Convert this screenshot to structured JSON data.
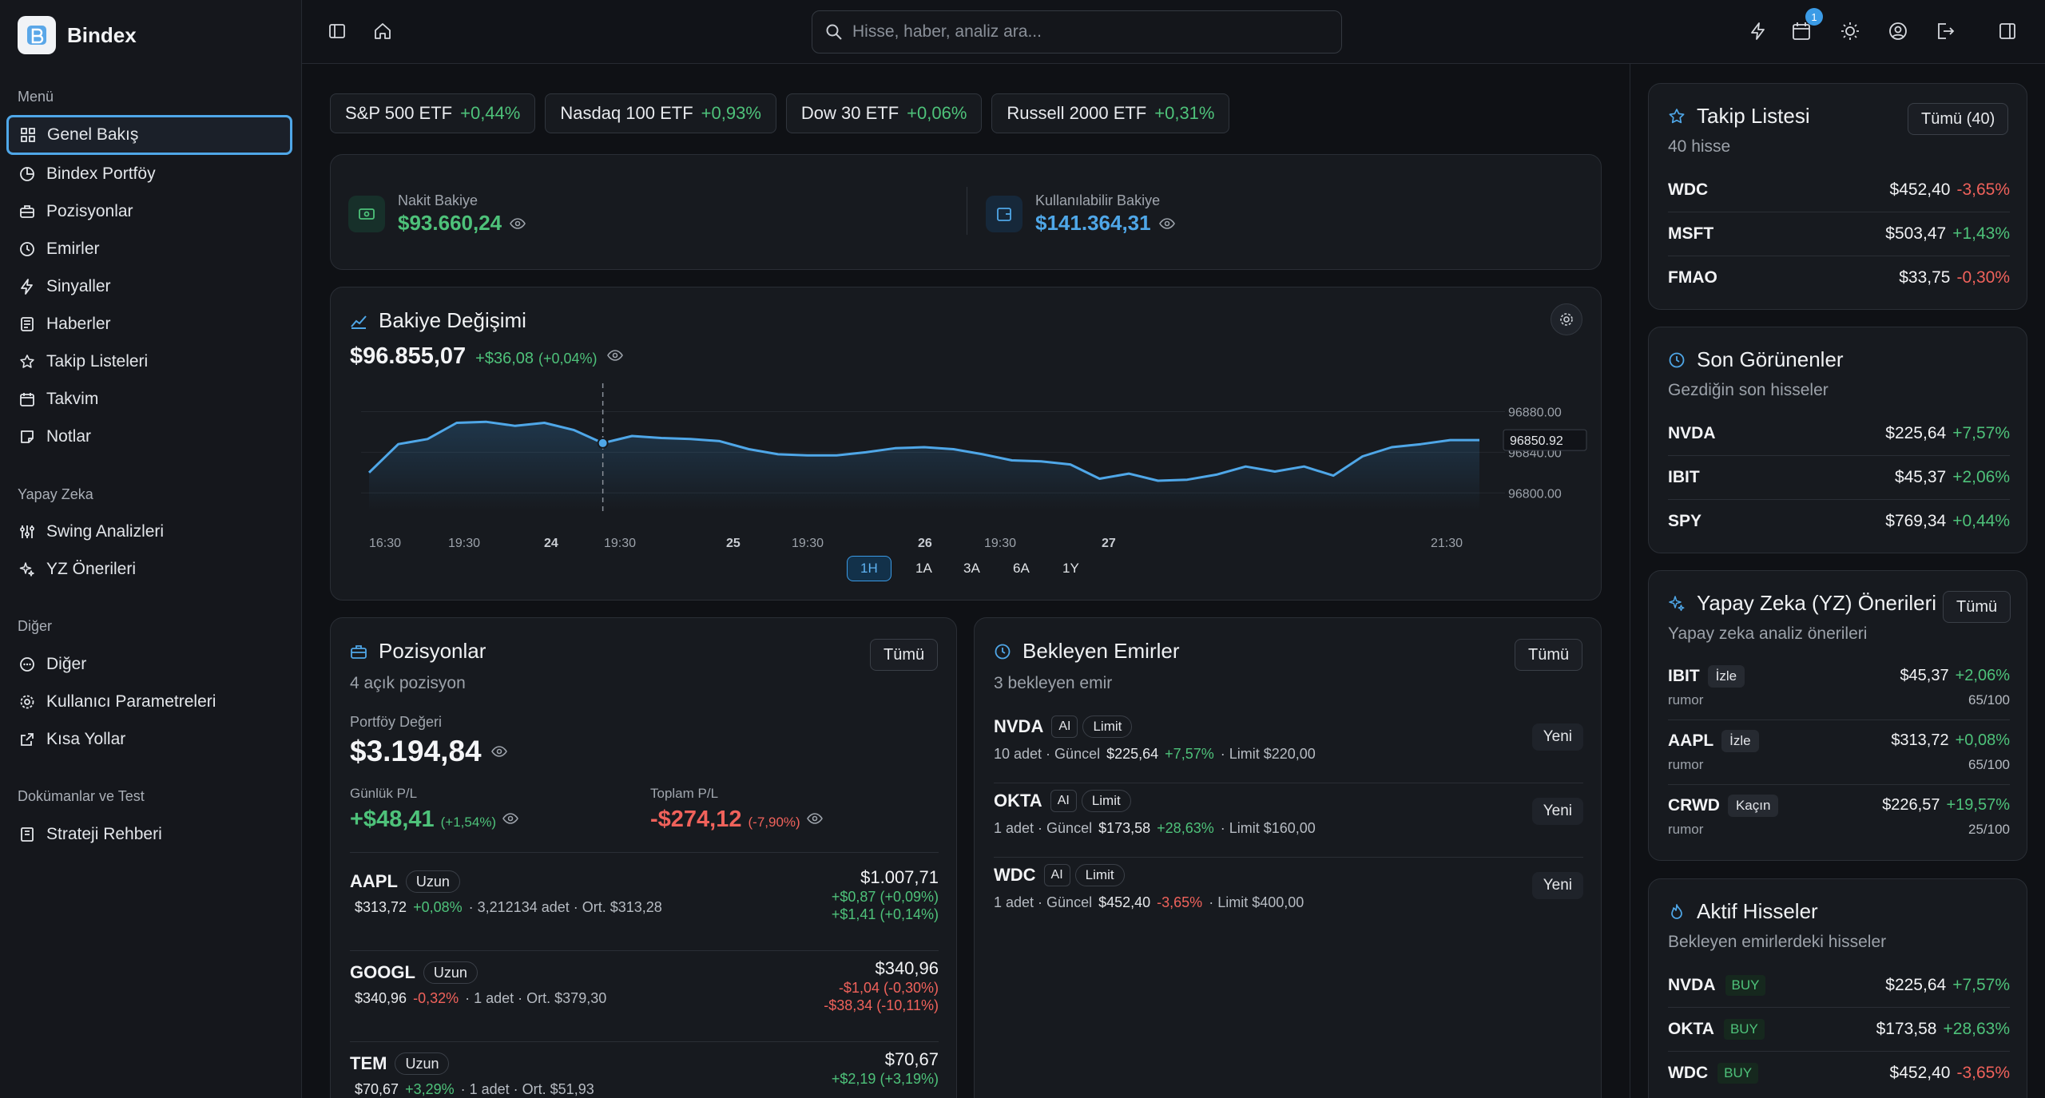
{
  "app": {
    "name": "Bindex"
  },
  "sidebar": {
    "sections": [
      {
        "title": "Menü",
        "items": [
          {
            "label": "Genel Bakış",
            "icon": "dashboard-icon"
          },
          {
            "label": "Bindex Portföy",
            "icon": "pie-chart-icon"
          },
          {
            "label": "Pozisyonlar",
            "icon": "briefcase-icon"
          },
          {
            "label": "Emirler",
            "icon": "clock-icon"
          },
          {
            "label": "Sinyaller",
            "icon": "lightning-icon"
          },
          {
            "label": "Haberler",
            "icon": "newspaper-icon"
          },
          {
            "label": "Takip Listeleri",
            "icon": "star-icon"
          },
          {
            "label": "Takvim",
            "icon": "calendar-icon"
          },
          {
            "label": "Notlar",
            "icon": "note-icon"
          }
        ]
      },
      {
        "title": "Yapay Zeka",
        "items": [
          {
            "label": "Swing Analizleri",
            "icon": "sliders-icon"
          },
          {
            "label": "YZ Önerileri",
            "icon": "sparkles-icon"
          }
        ]
      },
      {
        "title": "Diğer",
        "items": [
          {
            "label": "Diğer",
            "icon": "more-circle-icon"
          },
          {
            "label": "Kullanıcı Parametreleri",
            "icon": "gear-icon"
          },
          {
            "label": "Kısa Yollar",
            "icon": "external-link-icon"
          }
        ]
      },
      {
        "title": "Dokümanlar ve Test",
        "items": [
          {
            "label": "Strateji Rehberi",
            "icon": "book-icon"
          }
        ]
      }
    ]
  },
  "topbar": {
    "search_placeholder": "Hisse, haber, analiz ara...",
    "notification_count": "1"
  },
  "index_chips": [
    {
      "name": "S&P 500 ETF",
      "change": "+0,44%"
    },
    {
      "name": "Nasdaq 100 ETF",
      "change": "+0,93%"
    },
    {
      "name": "Dow 30 ETF",
      "change": "+0,06%"
    },
    {
      "name": "Russell 2000 ETF",
      "change": "+0,31%"
    }
  ],
  "balances": {
    "cash_label": "Nakit Bakiye",
    "cash_value": "$93.660,24",
    "available_label": "Kullanılabilir Bakiye",
    "available_value": "$141.364,31"
  },
  "balance_chart": {
    "title": "Bakiye Değişimi",
    "value": "$96.855,07",
    "change": "+$36,08",
    "change_pct": "(+0,04%)",
    "timeframes": [
      "1H",
      "1A",
      "3A",
      "6A",
      "1Y"
    ],
    "active_timeframe": "1H"
  },
  "chart_data": {
    "type": "area",
    "title": "Bakiye Değişimi",
    "x_ticks": [
      "16:30",
      "19:30",
      "24",
      "19:30",
      "25",
      "19:30",
      "26",
      "19:30",
      "27",
      "21:30"
    ],
    "y_ticks": [
      "96880.00",
      "96840.00",
      "96800.00"
    ],
    "ylim": [
      96790,
      96900
    ],
    "hover_value": "96850.92",
    "values": [
      96820,
      96848,
      96853,
      96869,
      96870,
      96866,
      96869,
      96862,
      96849,
      96856,
      96854,
      96853,
      96851,
      96843,
      96838,
      96837,
      96837,
      96840,
      96844,
      96845,
      96843,
      96838,
      96832,
      96831,
      96828,
      96814,
      96819,
      96812,
      96813,
      96818,
      96826,
      96821,
      96826,
      96817,
      96836,
      96845,
      96848,
      96852,
      96852
    ]
  },
  "positions": {
    "title": "Pozisyonlar",
    "subtitle": "4 açık pozisyon",
    "all_label": "Tümü",
    "portfolio_label": "Portföy Değeri",
    "portfolio_value": "$3.194,84",
    "daily_label": "Günlük P/L",
    "daily_value": "+$48,41",
    "daily_pct": "(+1,54%)",
    "total_label": "Toplam P/L",
    "total_value": "-$274,12",
    "total_pct": "(-7,90%)",
    "rows": [
      {
        "ticker": "AAPL",
        "tag": "Uzun",
        "price": "$313,72",
        "chg": "+0,08%",
        "rest": "· 3,212134 adet · Ort. $313,28",
        "value": "$1.007,71",
        "pl1": "+$0,87 (+0,09%)",
        "pl2": "+$1,41 (+0,14%)",
        "neg": false,
        "neg1": false,
        "neg2": false
      },
      {
        "ticker": "GOOGL",
        "tag": "Uzun",
        "price": "$340,96",
        "chg": "-0,32%",
        "rest": "· 1 adet · Ort. $379,30",
        "value": "$340,96",
        "pl1": "-$1,04 (-0,30%)",
        "pl2": "-$38,34 (-10,11%)",
        "neg": true,
        "neg1": true,
        "neg2": true
      },
      {
        "ticker": "TEM",
        "tag": "Uzun",
        "price": "$70,67",
        "chg": "+3,29%",
        "rest": "· 1 adet · Ort. $51,93",
        "value": "$70,67",
        "pl1": "+$2,19 (+3,19%)",
        "pl2": "",
        "neg": false,
        "neg1": false,
        "neg2": false
      }
    ]
  },
  "orders": {
    "title": "Bekleyen Emirler",
    "subtitle": "3 bekleyen emir",
    "all_label": "Tümü",
    "rows": [
      {
        "ticker": "NVDA",
        "ai": "AI",
        "type": "Limit",
        "qty": "10 adet · Güncel",
        "price": "$225,64",
        "chg": "+7,57%",
        "limit": "· Limit $220,00",
        "status": "Yeni",
        "neg": false
      },
      {
        "ticker": "OKTA",
        "ai": "AI",
        "type": "Limit",
        "qty": "1 adet · Güncel",
        "price": "$173,58",
        "chg": "+28,63%",
        "limit": "· Limit $160,00",
        "status": "Yeni",
        "neg": false
      },
      {
        "ticker": "WDC",
        "ai": "AI",
        "type": "Limit",
        "qty": "1 adet · Güncel",
        "price": "$452,40",
        "chg": "-3,65%",
        "limit": "· Limit $400,00",
        "status": "Yeni",
        "neg": true
      }
    ]
  },
  "watchlist": {
    "title": "Takip Listesi",
    "subtitle": "40 hisse",
    "all_label": "Tümü (40)",
    "rows": [
      {
        "ticker": "WDC",
        "price": "$452,40",
        "chg": "-3,65%",
        "neg": true
      },
      {
        "ticker": "MSFT",
        "price": "$503,47",
        "chg": "+1,43%",
        "neg": false
      },
      {
        "ticker": "FMAO",
        "price": "$33,75",
        "chg": "-0,30%",
        "neg": true
      }
    ]
  },
  "recent": {
    "title": "Son Görünenler",
    "subtitle": "Gezdiğin son hisseler",
    "rows": [
      {
        "ticker": "NVDA",
        "price": "$225,64",
        "chg": "+7,57%",
        "neg": false
      },
      {
        "ticker": "IBIT",
        "price": "$45,37",
        "chg": "+2,06%",
        "neg": false
      },
      {
        "ticker": "SPY",
        "price": "$769,34",
        "chg": "+0,44%",
        "neg": false
      }
    ]
  },
  "ai_recs": {
    "title": "Yapay Zeka (YZ) Önerileri",
    "subtitle": "Yapay zeka analiz önerileri",
    "all_label": "Tümü",
    "rows": [
      {
        "ticker": "IBIT",
        "tag": "İzle",
        "source": "rumor",
        "price": "$45,37",
        "chg": "+2,06%",
        "score": "65/100",
        "neg": false
      },
      {
        "ticker": "AAPL",
        "tag": "İzle",
        "source": "rumor",
        "price": "$313,72",
        "chg": "+0,08%",
        "score": "65/100",
        "neg": false
      },
      {
        "ticker": "CRWD",
        "tag": "Kaçın",
        "source": "rumor",
        "price": "$226,57",
        "chg": "+19,57%",
        "score": "25/100",
        "neg": false
      }
    ]
  },
  "active": {
    "title": "Aktif Hisseler",
    "subtitle": "Bekleyen emirlerdeki hisseler",
    "rows": [
      {
        "ticker": "NVDA",
        "side": "BUY",
        "price": "$225,64",
        "chg": "+7,57%",
        "neg": false
      },
      {
        "ticker": "OKTA",
        "side": "BUY",
        "price": "$173,58",
        "chg": "+28,63%",
        "neg": false
      },
      {
        "ticker": "WDC",
        "side": "BUY",
        "price": "$452,40",
        "chg": "-3,65%",
        "neg": true
      }
    ]
  },
  "colors": {
    "accent": "#3b9be6",
    "positive": "#4ec27a",
    "negative": "#f0625b",
    "background": "#0f1115"
  }
}
